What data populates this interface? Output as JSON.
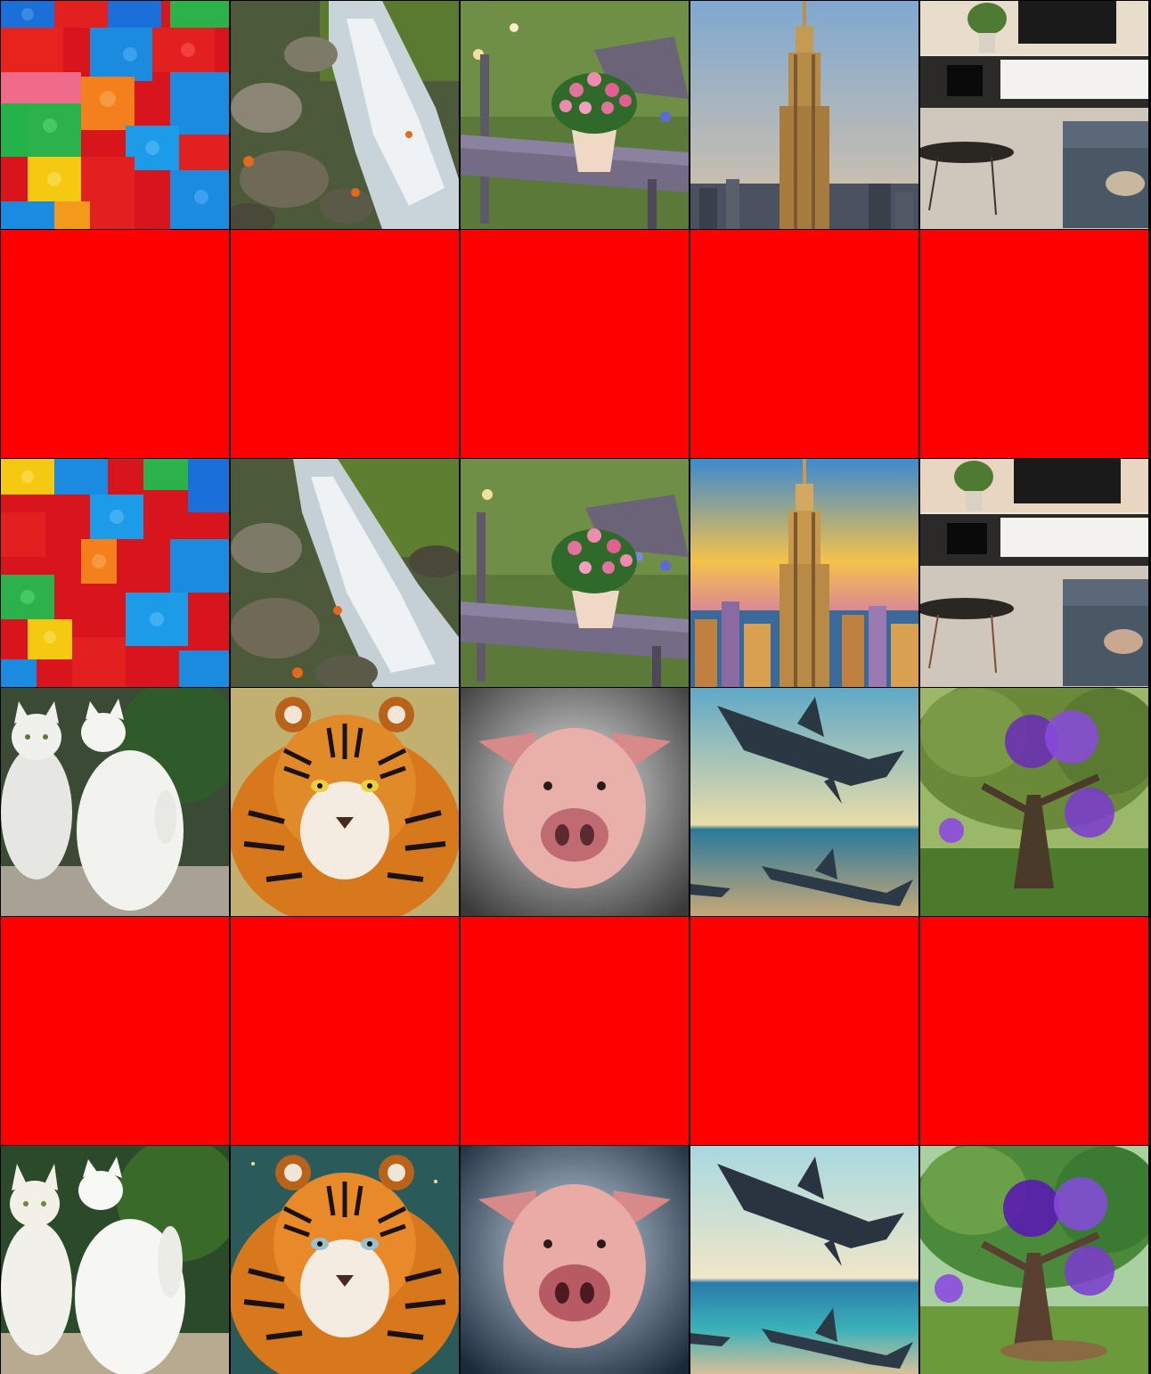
{
  "grid": {
    "columns": 5,
    "rows": 6,
    "placeholder_color": "#ff0000",
    "tiles": [
      {
        "row": 1,
        "col": 1,
        "subject": "lego-bricks"
      },
      {
        "row": 1,
        "col": 2,
        "subject": "mountain-stream"
      },
      {
        "row": 1,
        "col": 3,
        "subject": "flower-pot-on-bench"
      },
      {
        "row": 1,
        "col": 4,
        "subject": "empire-state-building"
      },
      {
        "row": 1,
        "col": 5,
        "subject": "living-room"
      },
      {
        "row": 2,
        "col": 1,
        "subject": "red-placeholder"
      },
      {
        "row": 2,
        "col": 2,
        "subject": "red-placeholder"
      },
      {
        "row": 2,
        "col": 3,
        "subject": "red-placeholder"
      },
      {
        "row": 2,
        "col": 4,
        "subject": "red-placeholder"
      },
      {
        "row": 2,
        "col": 5,
        "subject": "red-placeholder"
      },
      {
        "row": 3,
        "col": 1,
        "subject": "lego-bricks"
      },
      {
        "row": 3,
        "col": 2,
        "subject": "mountain-stream"
      },
      {
        "row": 3,
        "col": 3,
        "subject": "flower-pot-on-bench"
      },
      {
        "row": 3,
        "col": 4,
        "subject": "empire-state-building-sunset"
      },
      {
        "row": 3,
        "col": 5,
        "subject": "living-room"
      },
      {
        "row": 4,
        "col": 1,
        "subject": "white-cats"
      },
      {
        "row": 4,
        "col": 2,
        "subject": "tiger"
      },
      {
        "row": 4,
        "col": 3,
        "subject": "pig"
      },
      {
        "row": 4,
        "col": 4,
        "subject": "sharks"
      },
      {
        "row": 4,
        "col": 5,
        "subject": "tree-purple-balloons"
      },
      {
        "row": 5,
        "col": 1,
        "subject": "red-placeholder"
      },
      {
        "row": 5,
        "col": 2,
        "subject": "red-placeholder"
      },
      {
        "row": 5,
        "col": 3,
        "subject": "red-placeholder"
      },
      {
        "row": 5,
        "col": 4,
        "subject": "red-placeholder"
      },
      {
        "row": 5,
        "col": 5,
        "subject": "red-placeholder"
      },
      {
        "row": 6,
        "col": 1,
        "subject": "white-cats"
      },
      {
        "row": 6,
        "col": 2,
        "subject": "tiger"
      },
      {
        "row": 6,
        "col": 3,
        "subject": "pig"
      },
      {
        "row": 6,
        "col": 4,
        "subject": "sharks"
      },
      {
        "row": 6,
        "col": 5,
        "subject": "tree-purple-balloons"
      }
    ]
  }
}
